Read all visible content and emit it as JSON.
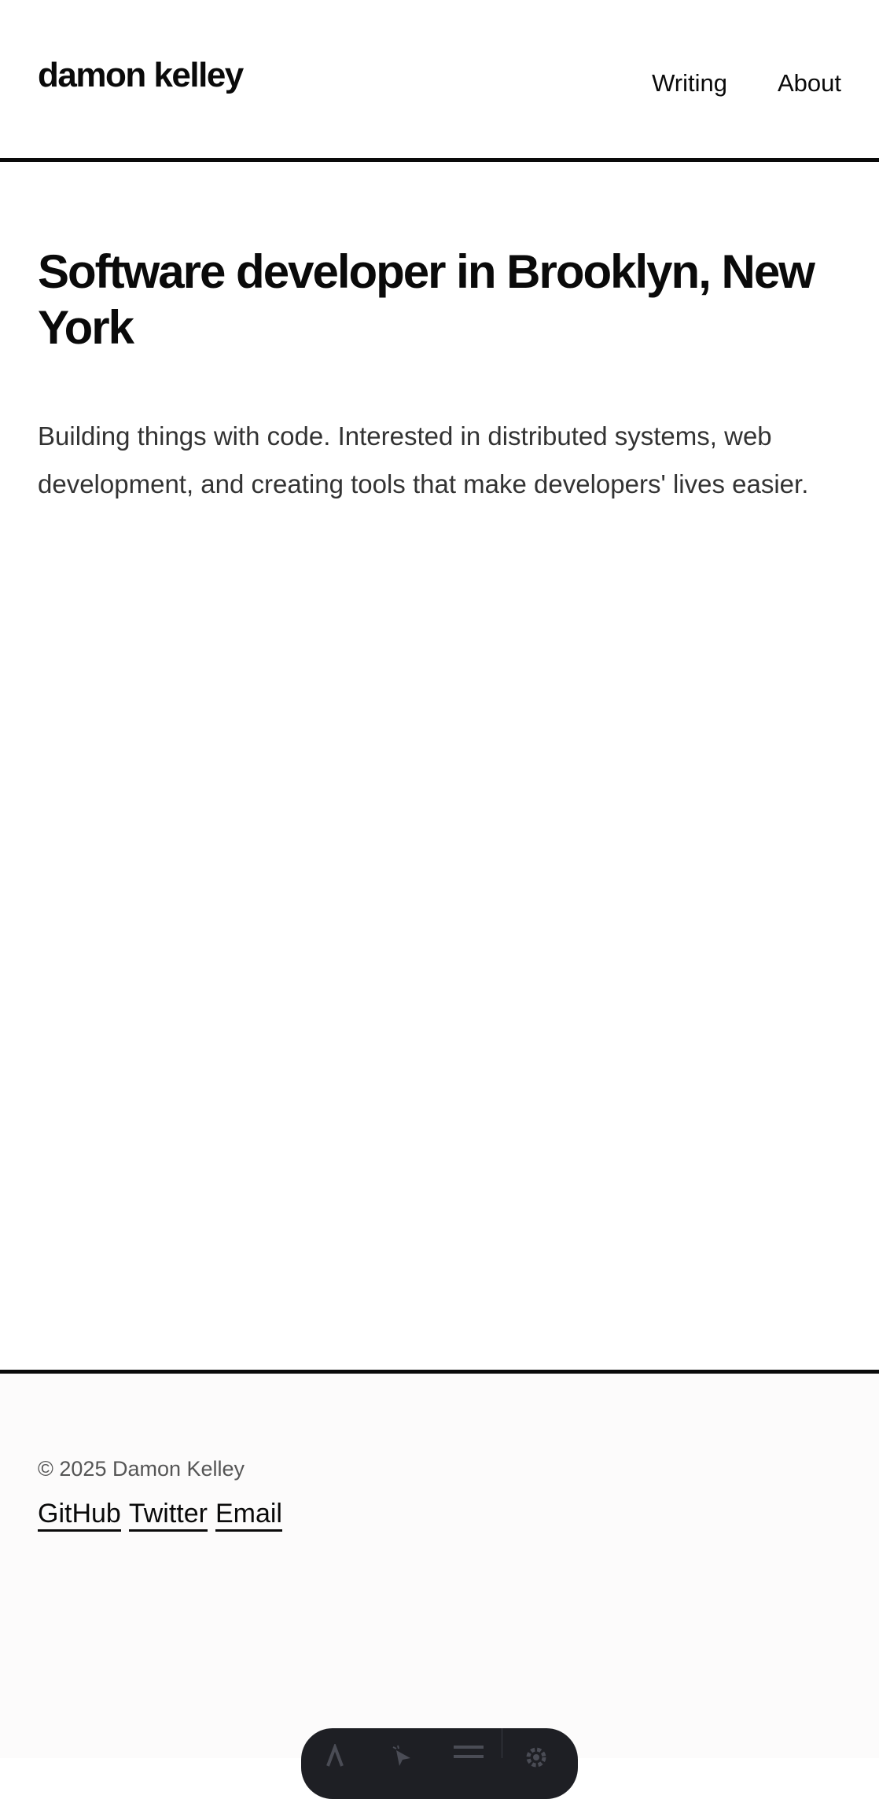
{
  "header": {
    "site_title": "damon kelley",
    "nav": [
      {
        "label": "Writing"
      },
      {
        "label": "About"
      }
    ]
  },
  "main": {
    "title": "Software developer in Brooklyn, New York",
    "intro": "Building things with code. Interested in distributed systems, web development, and creating tools that make developers' lives easier."
  },
  "footer": {
    "copyright": "© 2025 Damon Kelley",
    "links": [
      {
        "label": "GitHub"
      },
      {
        "label": "Twitter"
      },
      {
        "label": "Email"
      }
    ]
  },
  "toolbar": {
    "icons": [
      "text-icon",
      "pointer-icon",
      "menu-icon",
      "gear-icon"
    ],
    "colors": {
      "background": "#1e1f24",
      "icon": "#4a4c55"
    }
  }
}
